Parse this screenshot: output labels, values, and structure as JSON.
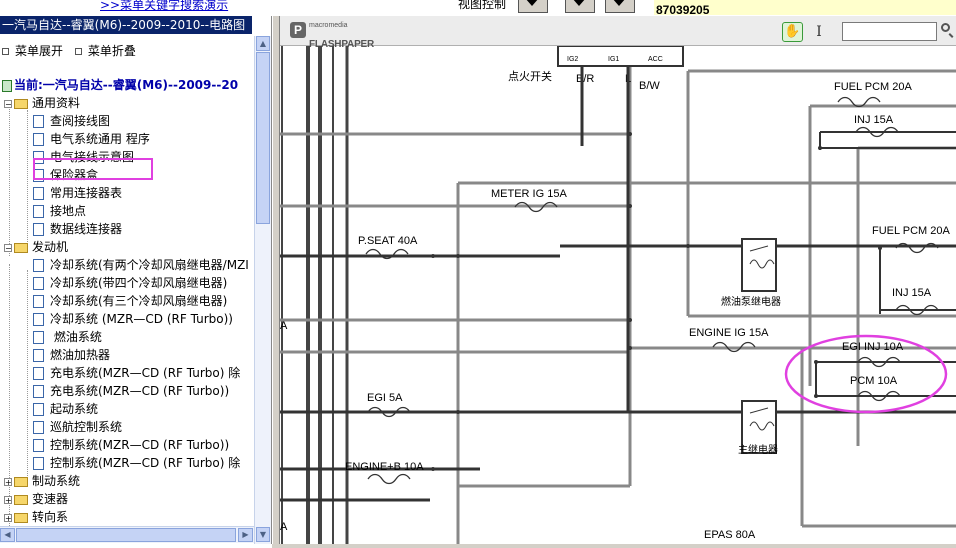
{
  "topbar": {
    "search_link": ">>菜单关键字搜索演示",
    "view_control": "视图控制",
    "phone": "87039205",
    "phone_note": ""
  },
  "left_panel": {
    "title": "一汽马自达--睿翼(M6)--2009--2010--电路图",
    "expand_all": "菜单展开",
    "collapse_all": "菜单折叠",
    "current": "当前:一汽马自达--睿翼(M6)--2009--20",
    "tree": [
      {
        "type": "folder",
        "label": "通用资料",
        "expanded": true
      },
      {
        "type": "doc",
        "label": "查阅接线图"
      },
      {
        "type": "doc",
        "label": "电气系统通用 程序"
      },
      {
        "type": "doc",
        "label": "电气接线示意图",
        "selected": true
      },
      {
        "type": "doc",
        "label": "保险器盒"
      },
      {
        "type": "doc",
        "label": "常用连接器表"
      },
      {
        "type": "doc",
        "label": "接地点"
      },
      {
        "type": "doc",
        "label": "数据线连接器"
      },
      {
        "type": "folder",
        "label": "发动机",
        "expanded": true
      },
      {
        "type": "doc",
        "label": "冷却系统(有两个冷却风扇继电器/MZI"
      },
      {
        "type": "doc",
        "label": "冷却系统(带四个冷却风扇继电器)"
      },
      {
        "type": "doc",
        "label": "冷却系统(有三个冷却风扇继电器)"
      },
      {
        "type": "doc",
        "label": "冷却系统 (MZR—CD (RF Turbo))"
      },
      {
        "type": "doc",
        "label": " 燃油系统"
      },
      {
        "type": "doc",
        "label": "燃油加热器"
      },
      {
        "type": "doc",
        "label": "充电系统(MZR—CD (RF Turbo)   除"
      },
      {
        "type": "doc",
        "label": "充电系统(MZR—CD (RF Turbo))"
      },
      {
        "type": "doc",
        "label": "起动系统"
      },
      {
        "type": "doc",
        "label": "巡航控制系统"
      },
      {
        "type": "doc",
        "label": "控制系统(MZR—CD (RF Turbo))"
      },
      {
        "type": "doc",
        "label": "控制系统(MZR—CD (RF Turbo)   除"
      },
      {
        "type": "folder",
        "label": "制动系统",
        "expanded": false
      },
      {
        "type": "folder",
        "label": "变速器",
        "expanded": false
      },
      {
        "type": "folder",
        "label": "转向系",
        "expanded": false
      }
    ]
  },
  "viewer": {
    "logo_line1": "macromedia",
    "logo_line2": "FLASHPAPER",
    "search_placeholder": ""
  },
  "diagram": {
    "ignition_switch": "点火开关",
    "switch_pins": [
      "IG2",
      "IG1",
      "ACC"
    ],
    "wire_colors": [
      "B/R",
      "L",
      "B/W"
    ],
    "fuses": {
      "fuel_pcm_top": "FUEL PCM 20A",
      "inj_top": "INJ 15A",
      "meter_ig": "METER IG 15A",
      "p_seat": "P.SEAT 40A",
      "fuel_pcm_right": "FUEL PCM 20A",
      "inj_right": "INJ 15A",
      "engine_ig": "ENGINE IG 15A",
      "egi_inj": "EGI INJ 10A",
      "pcm": "PCM 10A",
      "egi": "EGI 5A",
      "engine_b": "ENGINE+B 10A",
      "epas": "EPAS 80A"
    },
    "relays": {
      "fuel_pump": "燃油泵继电器",
      "main": "主继电器"
    },
    "edge_letters": [
      "A",
      "A"
    ]
  }
}
